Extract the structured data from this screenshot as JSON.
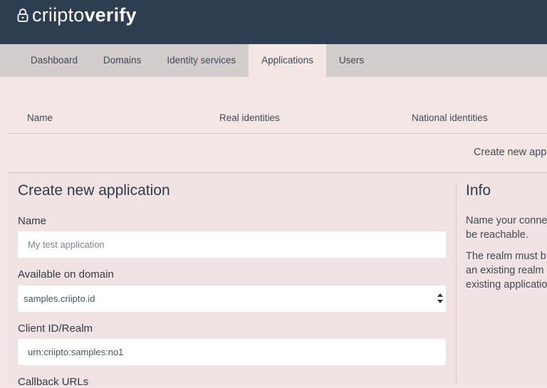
{
  "brand": {
    "logo_word1": "criipto",
    "logo_word2": "verify"
  },
  "nav": {
    "tabs": [
      {
        "label": "Dashboard"
      },
      {
        "label": "Domains"
      },
      {
        "label": "Identity services"
      },
      {
        "label": "Applications"
      },
      {
        "label": "Users"
      }
    ],
    "active_tab": "Applications"
  },
  "table": {
    "columns": [
      "Name",
      "Real identities",
      "National identities"
    ]
  },
  "actions": {
    "create_new_link": "Create new app"
  },
  "form": {
    "title": "Create new application",
    "name_label": "Name",
    "name_placeholder": "My test application",
    "domain_label": "Available on domain",
    "domain_value": "samples.criipto.id",
    "client_id_label": "Client ID/Realm",
    "client_id_value": "urn:criipto:samples:no1",
    "callback_label": "Callback URLs"
  },
  "info": {
    "title": "Info",
    "para1_line1": "Name your conne",
    "para1_line2": "be reachable.",
    "para2_line1": "The realm must b",
    "para2_line2": "an existing realm",
    "para2_line3": "existing applicatio"
  },
  "colors": {
    "header_bg": "#2d3e50",
    "nav_bg": "#d3cccc",
    "page_bg": "#f5e6e6",
    "text": "#2f3b49"
  }
}
